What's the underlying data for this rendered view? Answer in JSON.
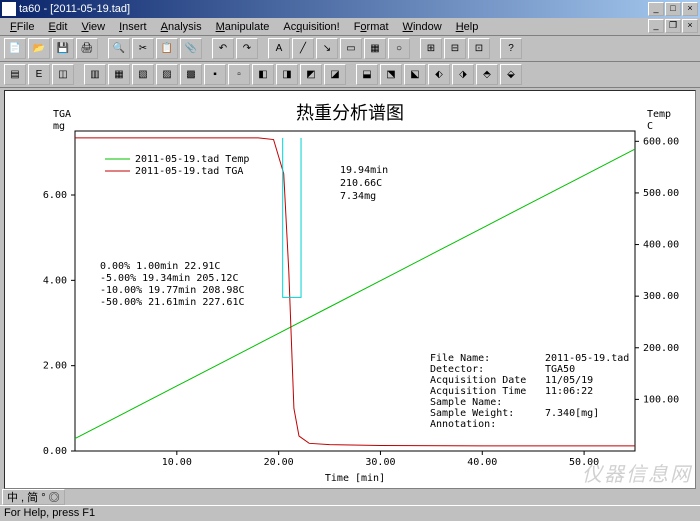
{
  "window": {
    "title": "ta60 - [2011-05-19.tad]",
    "buttons": {
      "min": "_",
      "max": "□",
      "close": "×"
    }
  },
  "menu": {
    "items": [
      "File",
      "Edit",
      "View",
      "Insert",
      "Analysis",
      "Manipulate",
      "Acquisition!",
      "Format",
      "Window",
      "Help"
    ]
  },
  "statusbar": {
    "text": "For Help, press F1"
  },
  "ime": {
    "text": "中 , 简 ° ◎"
  },
  "chart_data": {
    "type": "line",
    "title": "热重分析谱图",
    "xlabel": "Time [min]",
    "y_left": {
      "label": "TGA",
      "unit": "mg",
      "ticks": [
        0.0,
        2.0,
        4.0,
        6.0
      ],
      "range": [
        0,
        7.5
      ]
    },
    "y_right": {
      "label": "Temp",
      "unit": "C",
      "ticks": [
        100.0,
        200.0,
        300.0,
        400.0,
        500.0,
        600.0
      ],
      "range": [
        0,
        620
      ]
    },
    "x": {
      "ticks": [
        10.0,
        20.0,
        30.0,
        40.0,
        50.0
      ],
      "range": [
        0,
        55
      ]
    },
    "series": [
      {
        "name": "2011-05-19.tad Temp",
        "color": "#00c000",
        "axis": "right",
        "points": [
          [
            0,
            24
          ],
          [
            5,
            75
          ],
          [
            10,
            126
          ],
          [
            15,
            177
          ],
          [
            20,
            228
          ],
          [
            25,
            279
          ],
          [
            30,
            330
          ],
          [
            35,
            381
          ],
          [
            40,
            432
          ],
          [
            45,
            483
          ],
          [
            50,
            534
          ],
          [
            55,
            585
          ]
        ]
      },
      {
        "name": "2011-05-19.tad TGA",
        "color": "#c00000",
        "axis": "left",
        "points": [
          [
            0,
            7.34
          ],
          [
            18,
            7.34
          ],
          [
            19.5,
            7.3
          ],
          [
            20.5,
            6.5
          ],
          [
            21,
            4.2
          ],
          [
            21.5,
            1.0
          ],
          [
            22,
            0.35
          ],
          [
            23,
            0.18
          ],
          [
            25,
            0.15
          ],
          [
            30,
            0.13
          ],
          [
            40,
            0.12
          ],
          [
            55,
            0.12
          ]
        ]
      },
      {
        "name": "marker",
        "color": "#00d0d0",
        "axis": "left",
        "points": [
          [
            20.4,
            7.34
          ],
          [
            20.4,
            3.6
          ],
          [
            22.2,
            3.6
          ],
          [
            22.2,
            7.34
          ]
        ]
      }
    ],
    "annotations": {
      "point_label": [
        "19.94min",
        "210.66C",
        "7.34mg"
      ],
      "loss_table": [
        "0.00% 1.00min 22.91C",
        "-5.00% 19.34min 205.12C",
        "-10.00% 19.77min 208.98C",
        "-50.00% 21.61min 227.61C"
      ],
      "info": {
        "File Name:": "2011-05-19.tad",
        "Detector:": "TGA50",
        "Acquisition Date": "11/05/19",
        "Acquisition Time": "11:06:22",
        "Sample Name:": "",
        "Sample Weight:": "7.340[mg]",
        "Annotation:": ""
      }
    }
  },
  "watermark": "仪器信息网"
}
